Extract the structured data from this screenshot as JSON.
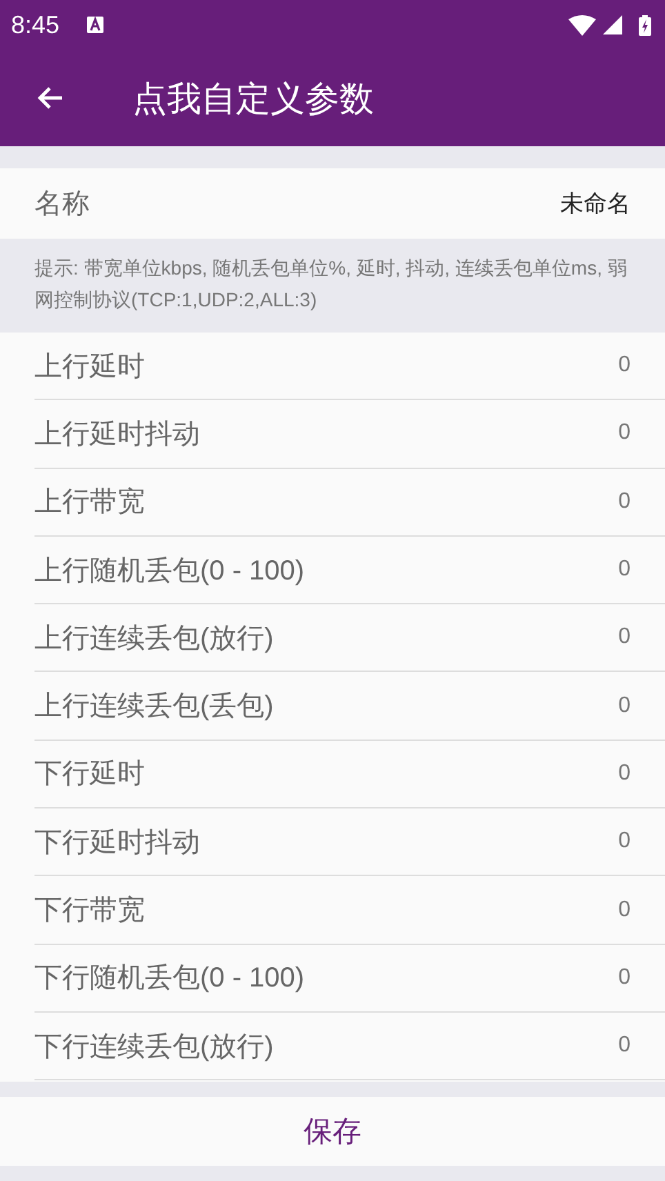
{
  "status_bar": {
    "time": "8:45"
  },
  "toolbar": {
    "title": "点我自定义参数"
  },
  "name_row": {
    "label": "名称",
    "value": "未命名"
  },
  "hint": "提示: 带宽单位kbps, 随机丢包单位%, 延时, 抖动, 连续丢包单位ms, 弱网控制协议(TCP:1,UDP:2,ALL:3)",
  "params": [
    {
      "label": "上行延时",
      "value": "0"
    },
    {
      "label": "上行延时抖动",
      "value": "0"
    },
    {
      "label": "上行带宽",
      "value": "0"
    },
    {
      "label": "上行随机丢包(0 - 100)",
      "value": "0"
    },
    {
      "label": "上行连续丢包(放行)",
      "value": "0"
    },
    {
      "label": "上行连续丢包(丢包)",
      "value": "0"
    },
    {
      "label": "下行延时",
      "value": "0"
    },
    {
      "label": "下行延时抖动",
      "value": "0"
    },
    {
      "label": "下行带宽",
      "value": "0"
    },
    {
      "label": "下行随机丢包(0 - 100)",
      "value": "0"
    },
    {
      "label": "下行连续丢包(放行)",
      "value": "0"
    }
  ],
  "save_button": "保存"
}
